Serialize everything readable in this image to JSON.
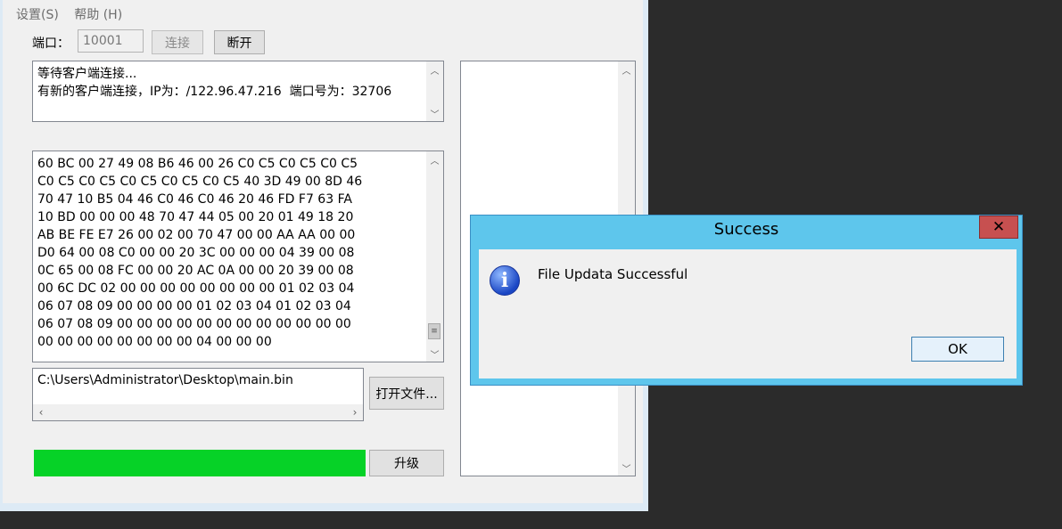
{
  "menu": {
    "settings": "设置(S)",
    "help": "帮助 (H)"
  },
  "port": {
    "label": "端口：",
    "value": "10001"
  },
  "buttons": {
    "connect": "连接",
    "disconnect": "断开",
    "open_file": "打开文件...",
    "upgrade": "升级"
  },
  "log": {
    "lines": [
      "等待客户端连接...",
      "有新的客户端连接，IP为：/122.96.47.216  端口号为：32706"
    ]
  },
  "hex": {
    "lines": [
      "60 BC 00 27 49 08 B6 46 00 26 C0 C5 C0 C5 C0 C5",
      "C0 C5 C0 C5 C0 C5 C0 C5 C0 C5 40 3D 49 00 8D 46",
      "70 47 10 B5 04 46 C0 46 C0 46 20 46 FD F7 63 FA",
      "10 BD 00 00 00 48 70 47 44 05 00 20 01 49 18 20",
      "AB BE FE E7 26 00 02 00 70 47 00 00 AA AA 00 00",
      "D0 64 00 08 C0 00 00 20 3C 00 00 00 04 39 00 08",
      "0C 65 00 08 FC 00 00 20 AC 0A 00 00 20 39 00 08",
      "00 6C DC 02 00 00 00 00 00 00 00 00 01 02 03 04",
      "06 07 08 09 00 00 00 00 01 02 03 04 01 02 03 04",
      "06 07 08 09 00 00 00 00 00 00 00 00 00 00 00 00",
      "00 00 00 00 00 00 00 00 04 00 00 00"
    ]
  },
  "file_path": "C:\\Users\\Administrator\\Desktop\\main.bin",
  "progress": {
    "percent": 100,
    "color": "#06d227"
  },
  "dialog": {
    "title": "Success",
    "close": "✕",
    "message": "File Updata Successful",
    "ok": "OK",
    "icon": "info-icon"
  }
}
